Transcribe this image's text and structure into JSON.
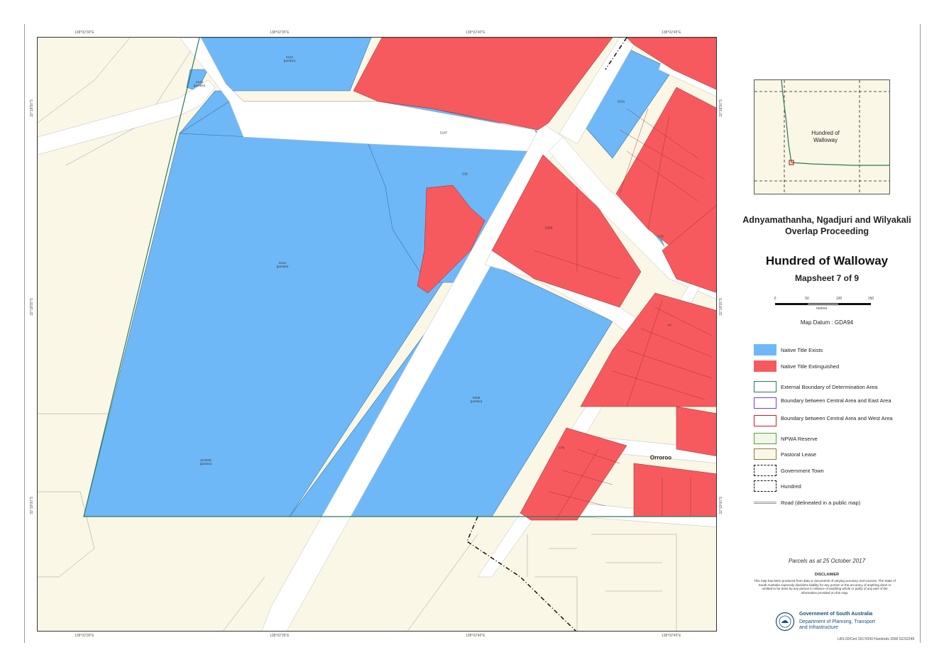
{
  "map": {
    "colors": {
      "native_title_exists": "#6fb8f7",
      "native_title_extinguished": "#f75a5e",
      "pastoral_lease": "#faf7e6",
      "road": "#ffffff",
      "external_boundary": "#2a7a5a",
      "central_east_boundary": "#7b3fc8",
      "central_west_boundary": "#c82020",
      "npwa_reserve": "#5aa03c"
    },
    "coord_labels_top": [
      "138°02'30\"E",
      "138°02'35\"E",
      "138°02'40\"E",
      "138°02'45\"E"
    ],
    "coord_labels_bottom": [
      "138°02'30\"E",
      "138°02'35\"E",
      "138°02'40\"E",
      "138°02'45\"E"
    ],
    "coord_labels_left": [
      "32°18'50\"S",
      "32°18'55\"S",
      "32°19'00\"S"
    ],
    "coord_labels_right": [
      "32°18'50\"S",
      "32°18'55\"S",
      "32°19'00\"S"
    ],
    "town_name": "Orroroo",
    "parcel_labels": [
      "S141\n(portion)",
      "S141\n(portion)",
      "S147",
      "S141\n(portion)",
      "S141",
      "S32",
      "Q1XDD\n(portion)",
      "S335\n(portion)",
      "S333",
      "A76",
      "A5",
      "A78"
    ]
  },
  "legend": {
    "inset_label": "Hundred of Walloway",
    "proceeding_title": "Adnyamathanha, Ngadjuri and Wilyakali Overlap Proceeding",
    "sheet_title": "Hundred of Walloway",
    "sheet_subtitle": "Mapsheet 7 of 9",
    "scale_ticks": [
      "0",
      "50",
      "100",
      "150"
    ],
    "scale_unit": "metres",
    "datum": "Map Datum : GDA94",
    "items": [
      {
        "label": "Native Title Exists",
        "swatch": "native-title-exists"
      },
      {
        "label": "Native Title Extinguished",
        "swatch": "native-title-extinguished"
      },
      {
        "label": "External Boundary of Determination Area",
        "swatch": "external-boundary"
      },
      {
        "label": "Boundary between Central Area and East Area",
        "swatch": "central-east-boundary"
      },
      {
        "label": "Boundary between Central Area and West Area",
        "swatch": "central-west-boundary"
      },
      {
        "label": "NPWA Reserve",
        "swatch": "npwa-reserve"
      },
      {
        "label": "Pastoral Lease",
        "swatch": "pastoral-lease"
      },
      {
        "label": "Government Town",
        "swatch": "government-town"
      },
      {
        "label": "Hundred",
        "swatch": "hundred"
      },
      {
        "label": "Road (delineated in a public map)",
        "swatch": "road"
      }
    ],
    "parcels_date": "Parcels as at 25 October 2017",
    "disclaimer_title": "DISCLAIMER",
    "disclaimer_text": "This map has been produced from data or documents of varying accuracy and sources. The State of South Australia expressly disclaims liability for any portion or the accuracy of anything done or omitted to be done by any person in reliance of anything whole or partly of any part of the information provided on this map.",
    "gov_name": "Government of South Australia",
    "dept_name": "Department of Planning, Transport and Infrastructure"
  },
  "reference_code": "LRS 02/Cert 2017/043 Hundreds 2000 GC52249"
}
